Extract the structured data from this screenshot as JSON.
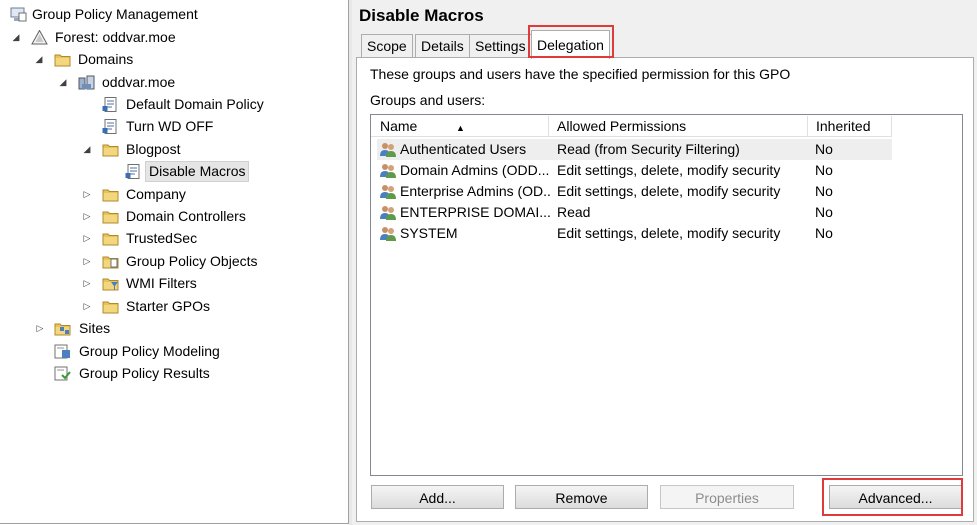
{
  "tree": {
    "root": "Group Policy Management",
    "forest": "Forest: oddvar.moe",
    "domains": "Domains",
    "domain": "oddvar.moe",
    "default_domain_policy": "Default Domain Policy",
    "turn_wd_off": "Turn WD OFF",
    "blogpost": "Blogpost",
    "disable_macros": "Disable Macros",
    "company": "Company",
    "domain_controllers": "Domain Controllers",
    "trustedsec": "TrustedSec",
    "group_policy_objects": "Group Policy Objects",
    "wmi_filters": "WMI Filters",
    "starter_gpos": "Starter GPOs",
    "sites": "Sites",
    "modeling": "Group Policy Modeling",
    "results": "Group Policy Results"
  },
  "panel": {
    "title": "Disable Macros",
    "tabs": [
      "Scope",
      "Details",
      "Settings",
      "Delegation"
    ],
    "active_tab": "Delegation",
    "description": "These groups and users have the specified permission for this GPO",
    "groups_label": "Groups and users:"
  },
  "list": {
    "columns": [
      "Name",
      "Allowed Permissions",
      "Inherited"
    ],
    "rows": [
      {
        "name": "Authenticated Users",
        "permission": "Read (from Security Filtering)",
        "inherited": "No"
      },
      {
        "name": "Domain Admins (ODD...",
        "permission": "Edit settings, delete, modify security",
        "inherited": "No"
      },
      {
        "name": "Enterprise Admins (OD...",
        "permission": "Edit settings, delete, modify security",
        "inherited": "No"
      },
      {
        "name": "ENTERPRISE DOMAI...",
        "permission": "Read",
        "inherited": "No"
      },
      {
        "name": "SYSTEM",
        "permission": "Edit settings, delete, modify security",
        "inherited": "No"
      }
    ]
  },
  "buttons": {
    "add": "Add...",
    "remove": "Remove",
    "properties": "Properties",
    "advanced": "Advanced..."
  },
  "colors": {
    "highlight_box": "#e03b3b",
    "folder": "#e8c35a",
    "selection": "#e5e5e5"
  }
}
